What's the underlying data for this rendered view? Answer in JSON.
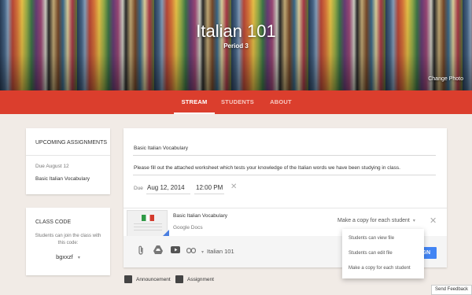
{
  "header": {
    "class_name": "Italian 101",
    "period": "Period 3",
    "change_photo": "Change Photo"
  },
  "nav": {
    "tabs": [
      {
        "label": "STREAM"
      },
      {
        "label": "STUDENTS"
      },
      {
        "label": "ABOUT"
      }
    ]
  },
  "sidebar": {
    "upcoming": {
      "title": "UPCOMING ASSIGNMENTS",
      "due": "Due August 12",
      "item": "Basic Italian Vocabulary"
    },
    "class_code": {
      "title": "CLASS CODE",
      "description": "Students can join the class with this code:",
      "code": "bgxxzf"
    }
  },
  "composer": {
    "title_value": "Basic Italian Vocabulary",
    "description_value": "Please fill out the attached worksheet which tests your knowledge of the Italian words we have been studying in class.",
    "due_label": "Due",
    "due_date": "Aug 12, 2014",
    "due_time": "12:00 PM",
    "attachment": {
      "title": "Basic Italian Vocabulary",
      "subtitle": "Google Docs",
      "copy_option": "Make a copy for each student"
    },
    "class_select": "Italian 101",
    "assign_button": "GN"
  },
  "dropdown": {
    "options": [
      "Students can view file",
      "Students can edit file",
      "Make a copy for each student"
    ]
  },
  "bottom_tabs": {
    "announcement": "Announcement",
    "assignment": "Assignment"
  },
  "feedback": "Send Feedback",
  "colors": {
    "nav_red": "#db3e2d",
    "assign_blue": "#4285f4",
    "page_bg": "#f1ebe6"
  }
}
